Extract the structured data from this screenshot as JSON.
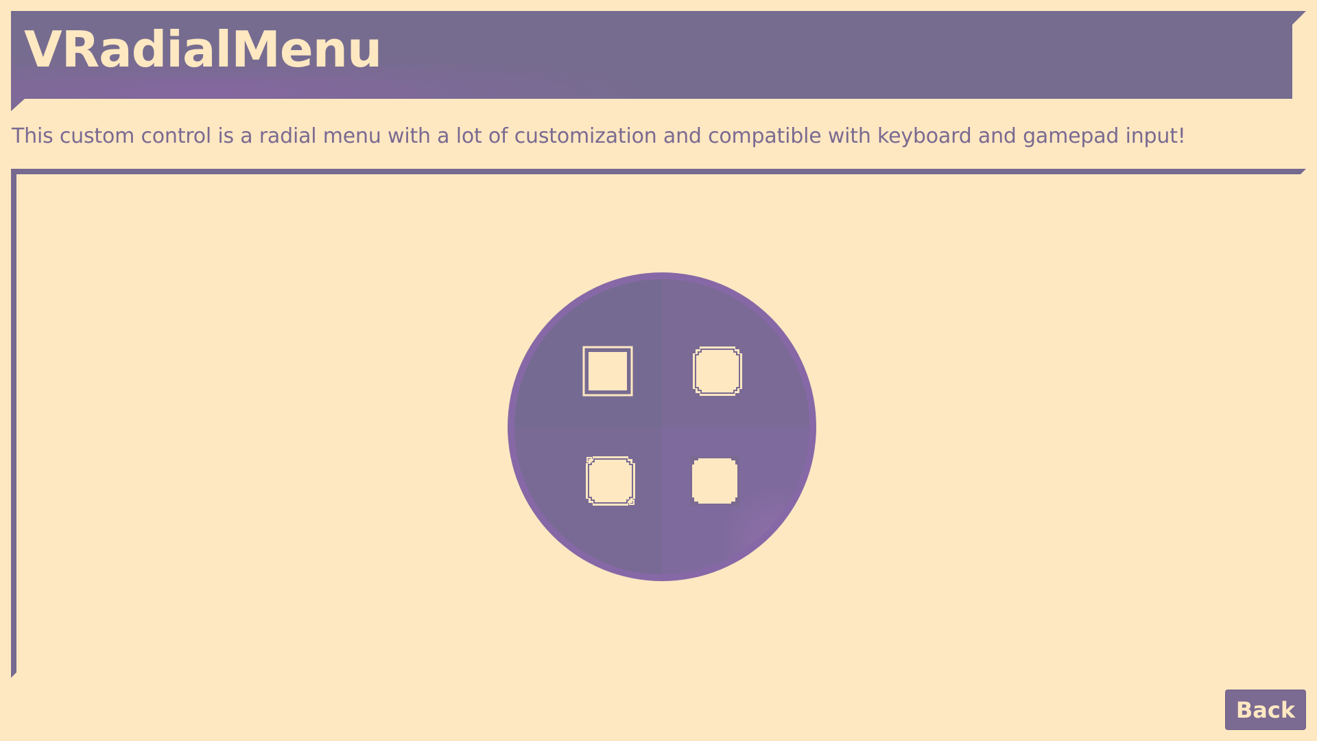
{
  "header": {
    "title": "VRadialMenu"
  },
  "description": "This custom control is a radial menu with a lot of customization and compatible with keyboard and gamepad input!",
  "radial_menu": {
    "item_count": 4,
    "items": [
      {
        "icon": "frame-square-icon"
      },
      {
        "icon": "frame-notched-icon"
      },
      {
        "icon": "frame-notched-icon"
      },
      {
        "icon": "frame-bracket-icon"
      }
    ],
    "highlighted_sector": 3
  },
  "footer": {
    "back_label": "Back"
  },
  "colors": {
    "background": "#fee8c2",
    "primary": "#776a91",
    "primary_light": "#8a6fa6",
    "text_light": "#fee8c2"
  }
}
